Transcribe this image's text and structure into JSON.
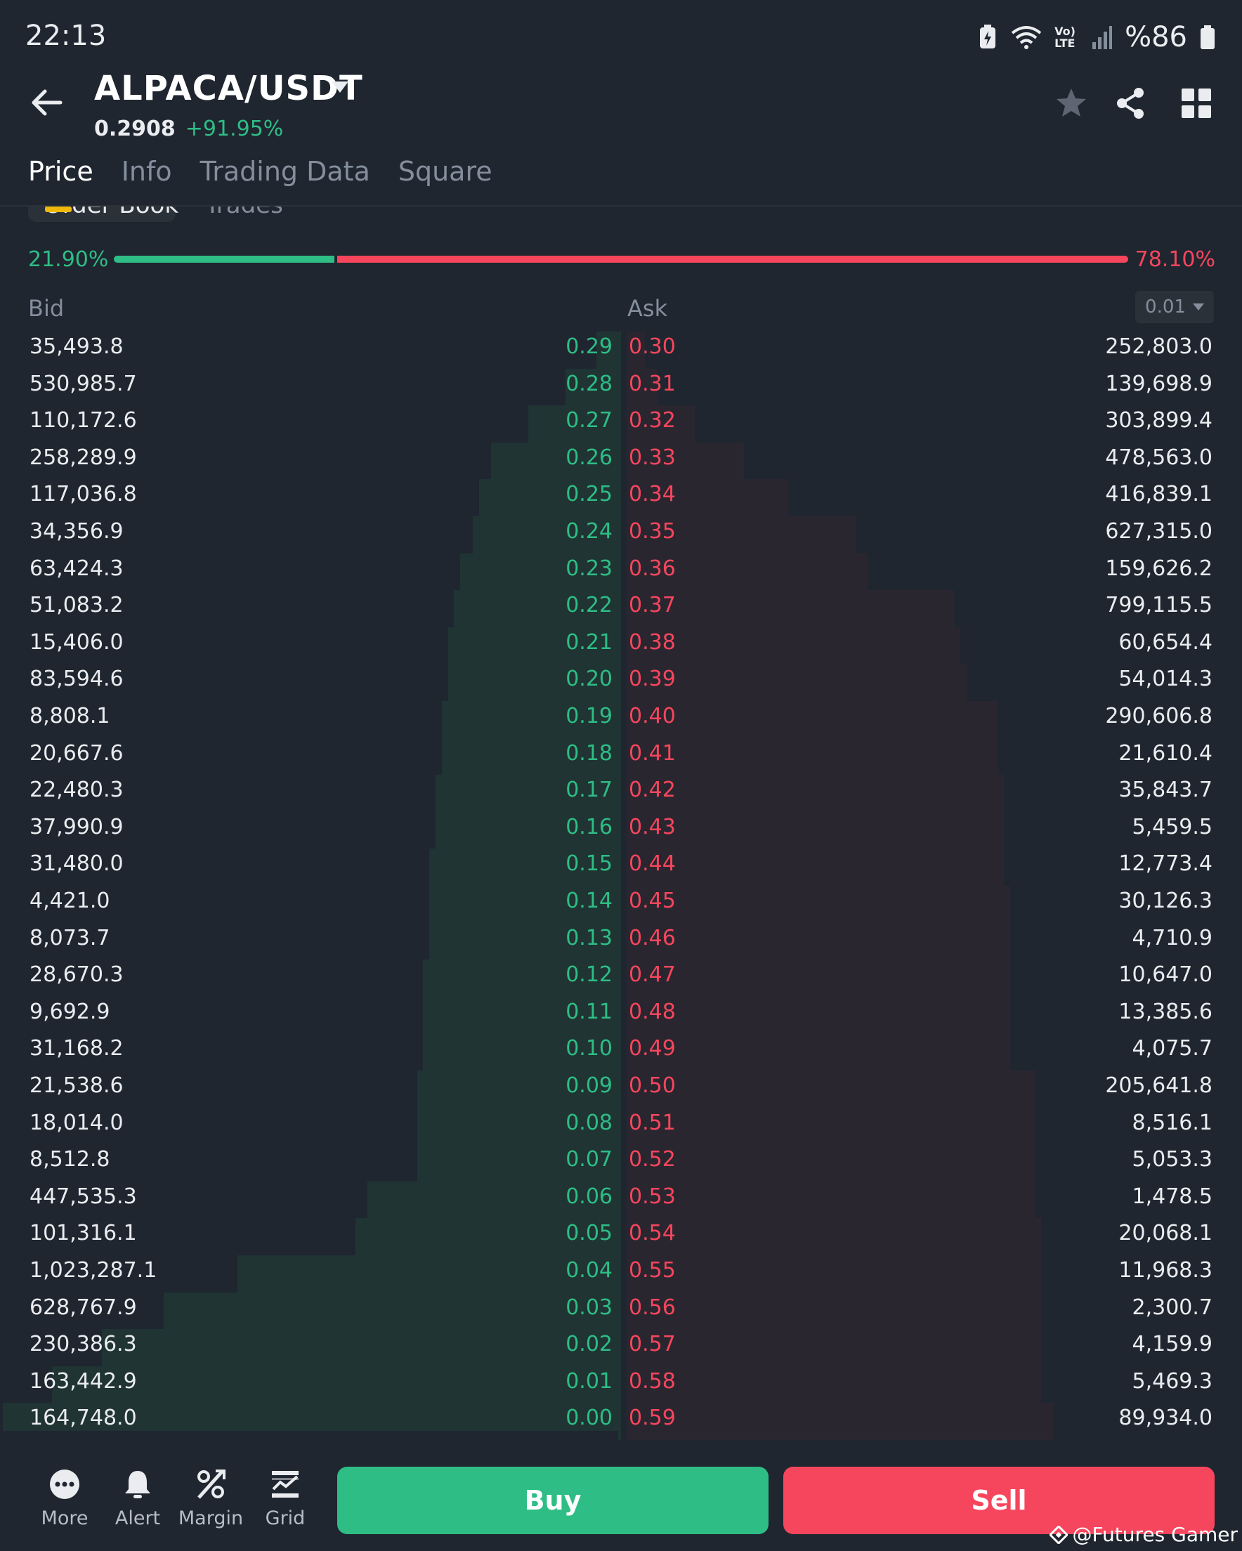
{
  "status_bar": {
    "time": "22:13",
    "network": "Vo) LTE",
    "battery": "%86"
  },
  "header": {
    "pair": "ALPACA/USDT",
    "last_price": "0.2908",
    "change_pct": "+91.95%"
  },
  "tabs": [
    {
      "label": "Price",
      "active": true
    },
    {
      "label": "Info",
      "active": false
    },
    {
      "label": "Trading Data",
      "active": false
    },
    {
      "label": "Square",
      "active": false
    }
  ],
  "subtabs": {
    "order_book": "Order Book",
    "trades": "Trades"
  },
  "ratio": {
    "bid_label": "21.90%",
    "ask_label": "78.10%",
    "bid_value": 21.9,
    "ask_value": 78.1
  },
  "book_header": {
    "bid": "Bid",
    "ask": "Ask",
    "precision": "0.01"
  },
  "bids": [
    {
      "qty": "35,493.8",
      "price": "0.29",
      "depth": 0.04
    },
    {
      "qty": "530,985.7",
      "price": "0.28",
      "depth": 0.09
    },
    {
      "qty": "110,172.6",
      "price": "0.27",
      "depth": 0.15
    },
    {
      "qty": "258,289.9",
      "price": "0.26",
      "depth": 0.21
    },
    {
      "qty": "117,036.8",
      "price": "0.25",
      "depth": 0.23
    },
    {
      "qty": "34,356.9",
      "price": "0.24",
      "depth": 0.24
    },
    {
      "qty": "63,424.3",
      "price": "0.23",
      "depth": 0.26
    },
    {
      "qty": "51,083.2",
      "price": "0.22",
      "depth": 0.27
    },
    {
      "qty": "15,406.0",
      "price": "0.21",
      "depth": 0.28
    },
    {
      "qty": "83,594.6",
      "price": "0.20",
      "depth": 0.28
    },
    {
      "qty": "8,808.1",
      "price": "0.19",
      "depth": 0.29
    },
    {
      "qty": "20,667.6",
      "price": "0.18",
      "depth": 0.29
    },
    {
      "qty": "22,480.3",
      "price": "0.17",
      "depth": 0.3
    },
    {
      "qty": "37,990.9",
      "price": "0.16",
      "depth": 0.3
    },
    {
      "qty": "31,480.0",
      "price": "0.15",
      "depth": 0.31
    },
    {
      "qty": "4,421.0",
      "price": "0.14",
      "depth": 0.31
    },
    {
      "qty": "8,073.7",
      "price": "0.13",
      "depth": 0.31
    },
    {
      "qty": "28,670.3",
      "price": "0.12",
      "depth": 0.32
    },
    {
      "qty": "9,692.9",
      "price": "0.11",
      "depth": 0.32
    },
    {
      "qty": "31,168.2",
      "price": "0.10",
      "depth": 0.32
    },
    {
      "qty": "21,538.6",
      "price": "0.09",
      "depth": 0.33
    },
    {
      "qty": "18,014.0",
      "price": "0.08",
      "depth": 0.33
    },
    {
      "qty": "8,512.8",
      "price": "0.07",
      "depth": 0.33
    },
    {
      "qty": "447,535.3",
      "price": "0.06",
      "depth": 0.41
    },
    {
      "qty": "101,316.1",
      "price": "0.05",
      "depth": 0.43
    },
    {
      "qty": "1,023,287.1",
      "price": "0.04",
      "depth": 0.62
    },
    {
      "qty": "628,767.9",
      "price": "0.03",
      "depth": 0.74
    },
    {
      "qty": "230,386.3",
      "price": "0.02",
      "depth": 0.84
    },
    {
      "qty": "163,442.9",
      "price": "0.01",
      "depth": 0.92
    },
    {
      "qty": "164,748.0",
      "price": "0.00",
      "depth": 1.0
    }
  ],
  "asks": [
    {
      "price": "0.30",
      "qty": "252,803.0",
      "depth": 0.03
    },
    {
      "price": "0.31",
      "qty": "139,698.9",
      "depth": 0.05
    },
    {
      "price": "0.32",
      "qty": "303,899.4",
      "depth": 0.11
    },
    {
      "price": "0.33",
      "qty": "478,563.0",
      "depth": 0.19
    },
    {
      "price": "0.34",
      "qty": "416,839.1",
      "depth": 0.26
    },
    {
      "price": "0.35",
      "qty": "627,315.0",
      "depth": 0.37
    },
    {
      "price": "0.36",
      "qty": "159,626.2",
      "depth": 0.39
    },
    {
      "price": "0.37",
      "qty": "799,115.5",
      "depth": 0.53
    },
    {
      "price": "0.38",
      "qty": "60,654.4",
      "depth": 0.54
    },
    {
      "price": "0.39",
      "qty": "54,014.3",
      "depth": 0.55
    },
    {
      "price": "0.40",
      "qty": "290,606.8",
      "depth": 0.6
    },
    {
      "price": "0.41",
      "qty": "21,610.4",
      "depth": 0.6
    },
    {
      "price": "0.42",
      "qty": "35,843.7",
      "depth": 0.61
    },
    {
      "price": "0.43",
      "qty": "5,459.5",
      "depth": 0.61
    },
    {
      "price": "0.44",
      "qty": "12,773.4",
      "depth": 0.61
    },
    {
      "price": "0.45",
      "qty": "30,126.3",
      "depth": 0.62
    },
    {
      "price": "0.46",
      "qty": "4,710.9",
      "depth": 0.62
    },
    {
      "price": "0.47",
      "qty": "10,647.0",
      "depth": 0.62
    },
    {
      "price": "0.48",
      "qty": "13,385.6",
      "depth": 0.62
    },
    {
      "price": "0.49",
      "qty": "4,075.7",
      "depth": 0.62
    },
    {
      "price": "0.50",
      "qty": "205,641.8",
      "depth": 0.66
    },
    {
      "price": "0.51",
      "qty": "8,516.1",
      "depth": 0.66
    },
    {
      "price": "0.52",
      "qty": "5,053.3",
      "depth": 0.66
    },
    {
      "price": "0.53",
      "qty": "1,478.5",
      "depth": 0.66
    },
    {
      "price": "0.54",
      "qty": "20,068.1",
      "depth": 0.67
    },
    {
      "price": "0.55",
      "qty": "11,968.3",
      "depth": 0.67
    },
    {
      "price": "0.56",
      "qty": "2,300.7",
      "depth": 0.67
    },
    {
      "price": "0.57",
      "qty": "4,159.9",
      "depth": 0.67
    },
    {
      "price": "0.58",
      "qty": "5,469.3",
      "depth": 0.67
    },
    {
      "price": "0.59",
      "qty": "89,934.0",
      "depth": 0.69
    }
  ],
  "bottom_nav": [
    {
      "label": "More",
      "icon": "more-icon"
    },
    {
      "label": "Alert",
      "icon": "bell-icon"
    },
    {
      "label": "Margin",
      "icon": "percent-icon"
    },
    {
      "label": "Grid",
      "icon": "grid-bot-icon"
    }
  ],
  "actions": {
    "buy": "Buy",
    "sell": "Sell"
  },
  "watermark": "@Futures Gamer",
  "colors": {
    "bid": "#2ebd85",
    "ask": "#f6465d",
    "accent": "#f0b90b",
    "background": "#1f2630"
  }
}
